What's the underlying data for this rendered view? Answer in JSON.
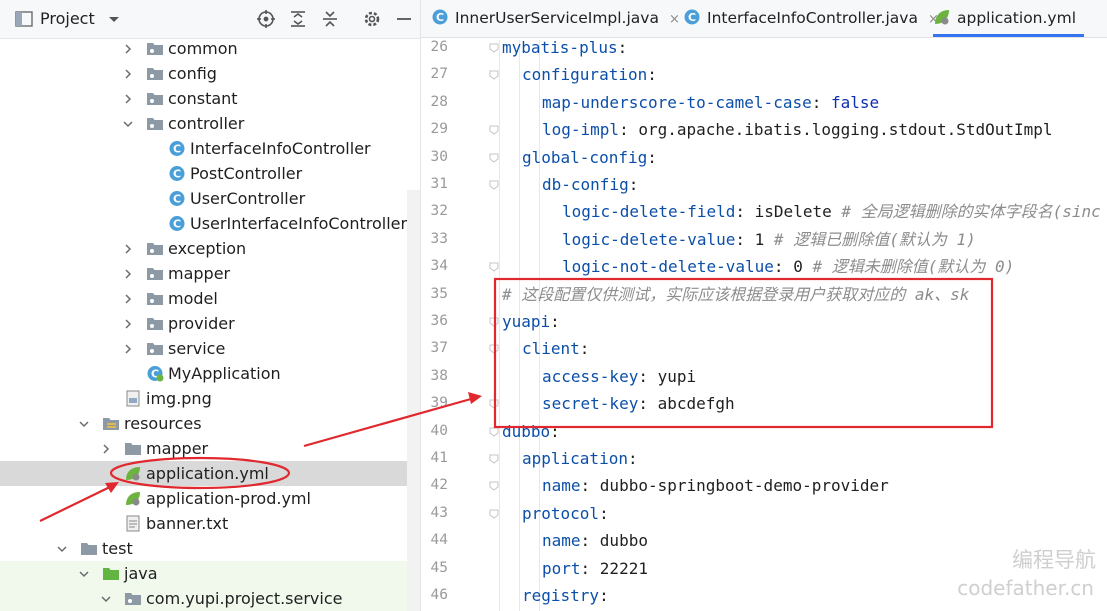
{
  "panel": {
    "title": "Project",
    "header_icons": [
      "dropdown-icon",
      "target-icon",
      "expand-all-icon",
      "collapse-all-icon",
      "gear-icon",
      "minimize-icon"
    ]
  },
  "tree": [
    {
      "label": "common",
      "type": "package",
      "expanded": false
    },
    {
      "label": "config",
      "type": "package",
      "expanded": false
    },
    {
      "label": "constant",
      "type": "package",
      "expanded": false
    },
    {
      "label": "controller",
      "type": "package",
      "expanded": true
    },
    {
      "label": "InterfaceInfoController",
      "type": "class"
    },
    {
      "label": "PostController",
      "type": "class"
    },
    {
      "label": "UserController",
      "type": "class"
    },
    {
      "label": "UserInterfaceInfoController",
      "type": "class"
    },
    {
      "label": "exception",
      "type": "package",
      "expanded": false
    },
    {
      "label": "mapper",
      "type": "package",
      "expanded": false
    },
    {
      "label": "model",
      "type": "package",
      "expanded": false
    },
    {
      "label": "provider",
      "type": "package",
      "expanded": false
    },
    {
      "label": "service",
      "type": "package",
      "expanded": false
    },
    {
      "label": "MyApplication",
      "type": "spring-class"
    },
    {
      "label": "img.png",
      "type": "image"
    },
    {
      "label": "resources",
      "type": "resources-folder",
      "expanded": true
    },
    {
      "label": "mapper",
      "type": "folder",
      "expanded": false
    },
    {
      "label": "application.yml",
      "type": "yml",
      "selected": true
    },
    {
      "label": "application-prod.yml",
      "type": "yml"
    },
    {
      "label": "banner.txt",
      "type": "text"
    },
    {
      "label": "test",
      "type": "folder",
      "expanded": true
    },
    {
      "label": "java",
      "type": "test-source-folder",
      "expanded": true
    },
    {
      "label": "com.yupi.project.service",
      "type": "package",
      "expanded": true
    }
  ],
  "tabs": [
    {
      "label": "InnerUserServiceImpl.java",
      "icon": "java-class-icon",
      "active": false
    },
    {
      "label": "InterfaceInfoController.java",
      "icon": "java-class-icon",
      "active": false
    },
    {
      "label": "application.yml",
      "icon": "spring-yml-icon",
      "active": true
    }
  ],
  "tab_close": "×",
  "code_lines": [
    {
      "n": "26",
      "indent": 0,
      "parts": [
        [
          "k",
          "mybatis-plus"
        ],
        [
          "p",
          ":"
        ]
      ]
    },
    {
      "n": "27",
      "indent": 1,
      "parts": [
        [
          "k",
          "configuration"
        ],
        [
          "p",
          ":"
        ]
      ]
    },
    {
      "n": "28",
      "indent": 2,
      "parts": [
        [
          "k",
          "map-underscore-to-camel-case"
        ],
        [
          "p",
          ": "
        ],
        [
          "b",
          "false"
        ]
      ]
    },
    {
      "n": "29",
      "indent": 2,
      "parts": [
        [
          "k",
          "log-impl"
        ],
        [
          "p",
          ": "
        ],
        [
          "v",
          "org.apache.ibatis.logging.stdout.StdOutImpl"
        ]
      ]
    },
    {
      "n": "30",
      "indent": 1,
      "parts": [
        [
          "k",
          "global-config"
        ],
        [
          "p",
          ":"
        ]
      ]
    },
    {
      "n": "31",
      "indent": 2,
      "parts": [
        [
          "k",
          "db-config"
        ],
        [
          "p",
          ":"
        ]
      ]
    },
    {
      "n": "32",
      "indent": 3,
      "parts": [
        [
          "k",
          "logic-delete-field"
        ],
        [
          "p",
          ": "
        ],
        [
          "v",
          "isDelete "
        ],
        [
          "c",
          "# 全局逻辑删除的实体字段名(sinc"
        ]
      ]
    },
    {
      "n": "33",
      "indent": 3,
      "parts": [
        [
          "k",
          "logic-delete-value"
        ],
        [
          "p",
          ": "
        ],
        [
          "v",
          "1 "
        ],
        [
          "c",
          "# 逻辑已删除值(默认为 1)"
        ]
      ]
    },
    {
      "n": "34",
      "indent": 3,
      "parts": [
        [
          "k",
          "logic-not-delete-value"
        ],
        [
          "p",
          ": "
        ],
        [
          "v",
          "0 "
        ],
        [
          "c",
          "# 逻辑未删除值(默认为 0)"
        ]
      ]
    },
    {
      "n": "35",
      "indent": 0,
      "parts": [
        [
          "c",
          "# 这段配置仅供测试，实际应该根据登录用户获取对应的 ak、sk"
        ]
      ]
    },
    {
      "n": "36",
      "indent": 0,
      "parts": [
        [
          "k",
          "yuapi"
        ],
        [
          "p",
          ":"
        ]
      ]
    },
    {
      "n": "37",
      "indent": 1,
      "parts": [
        [
          "k",
          "client"
        ],
        [
          "p",
          ":"
        ]
      ]
    },
    {
      "n": "38",
      "indent": 2,
      "parts": [
        [
          "k",
          "access-key"
        ],
        [
          "p",
          ": "
        ],
        [
          "v",
          "yupi"
        ]
      ]
    },
    {
      "n": "39",
      "indent": 2,
      "parts": [
        [
          "k",
          "secret-key"
        ],
        [
          "p",
          ": "
        ],
        [
          "v",
          "abcdefgh"
        ]
      ]
    },
    {
      "n": "40",
      "indent": 0,
      "parts": [
        [
          "k",
          "dubbo"
        ],
        [
          "p",
          ":"
        ]
      ]
    },
    {
      "n": "41",
      "indent": 1,
      "parts": [
        [
          "k",
          "application"
        ],
        [
          "p",
          ":"
        ]
      ]
    },
    {
      "n": "42",
      "indent": 2,
      "parts": [
        [
          "k",
          "name"
        ],
        [
          "p",
          ": "
        ],
        [
          "v",
          "dubbo-springboot-demo-provider"
        ]
      ]
    },
    {
      "n": "43",
      "indent": 1,
      "parts": [
        [
          "k",
          "protocol"
        ],
        [
          "p",
          ":"
        ]
      ]
    },
    {
      "n": "44",
      "indent": 2,
      "parts": [
        [
          "k",
          "name"
        ],
        [
          "p",
          ": "
        ],
        [
          "v",
          "dubbo"
        ]
      ]
    },
    {
      "n": "45",
      "indent": 2,
      "parts": [
        [
          "k",
          "port"
        ],
        [
          "p",
          ": "
        ],
        [
          "v",
          "22221"
        ]
      ]
    },
    {
      "n": "46",
      "indent": 1,
      "parts": [
        [
          "k",
          "registry"
        ],
        [
          "p",
          ":"
        ]
      ]
    }
  ],
  "watermark": {
    "cn": "编程导航",
    "en": "codefather.cn"
  },
  "colors": {
    "key": "#0c4fa8",
    "bool": "#0c2fb2",
    "comment": "#8c8c8c",
    "annotation_red": "#e0282e",
    "selected_row": "#d9d9d9",
    "active_tab_underline": "#3574f0"
  }
}
